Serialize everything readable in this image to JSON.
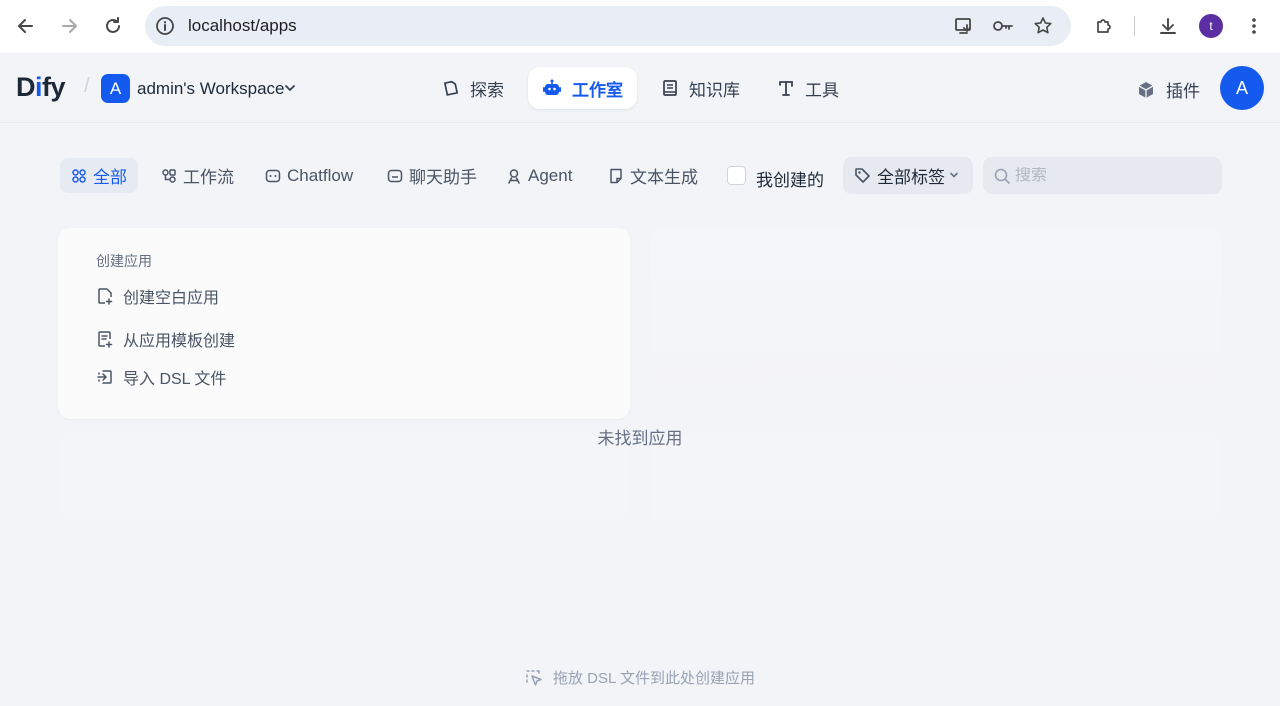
{
  "browser": {
    "url": "localhost/apps",
    "profile_initial": "t"
  },
  "header": {
    "logo_prefix": "D",
    "logo_i": "i",
    "logo_suffix": "fy",
    "workspace_initial": "A",
    "workspace_name": "admin's Workspace",
    "nav": [
      {
        "label": "探索",
        "icon": "explore-icon"
      },
      {
        "label": "工作室",
        "icon": "robot-icon",
        "active": true
      },
      {
        "label": "知识库",
        "icon": "book-icon"
      },
      {
        "label": "工具",
        "icon": "tool-icon"
      }
    ],
    "plugin_label": "插件",
    "user_initial": "A"
  },
  "filters": {
    "tabs": [
      {
        "label": "全部",
        "icon": "grid-icon",
        "active": true
      },
      {
        "label": "工作流",
        "icon": "workflow-icon"
      },
      {
        "label": "Chatflow",
        "icon": "chatflow-icon"
      },
      {
        "label": "聊天助手",
        "icon": "chat-bubble-icon"
      },
      {
        "label": "Agent",
        "icon": "agent-icon"
      },
      {
        "label": "文本生成",
        "icon": "text-doc-icon"
      }
    ],
    "mine_label": "我创建的",
    "mine_checked": false,
    "tag_label": "全部标签",
    "search_placeholder": "搜索"
  },
  "create_card": {
    "title": "创建应用",
    "items": [
      {
        "label": "创建空白应用",
        "icon": "new-file-icon"
      },
      {
        "label": "从应用模板创建",
        "icon": "template-icon"
      },
      {
        "label": "导入 DSL 文件",
        "icon": "import-icon"
      }
    ]
  },
  "empty_text": "未找到应用",
  "drop_hint": "拖放 DSL 文件到此处创建应用",
  "colors": {
    "accent": "#155aef",
    "page_bg": "#f2f4f7",
    "profile": "#5b2fa3"
  }
}
